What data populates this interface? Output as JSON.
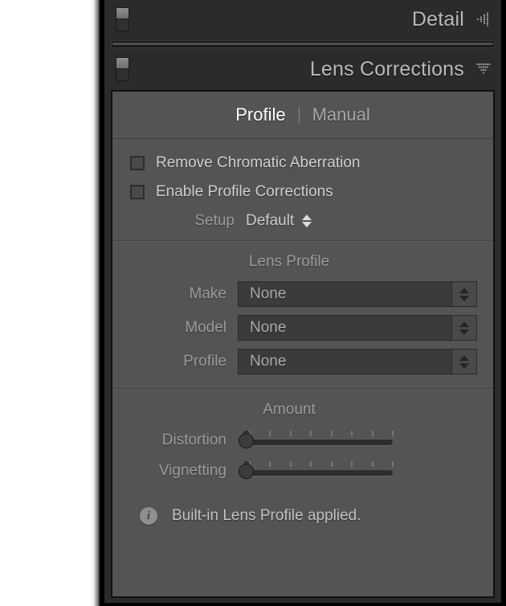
{
  "panels": [
    {
      "id": "detail",
      "title": "Detail",
      "toggle_state": "on",
      "collapse_icon": "dotted-triangle-left-icon",
      "expanded": false
    },
    {
      "id": "lens_corrections",
      "title": "Lens Corrections",
      "toggle_state": "on",
      "collapse_icon": "dotted-triangle-down-icon",
      "expanded": true
    }
  ],
  "lens_corrections": {
    "tabs": [
      {
        "label": "Profile",
        "active": true
      },
      {
        "label": "Manual",
        "active": false
      }
    ],
    "tab_separator": "|",
    "checkboxes": [
      {
        "label": "Remove Chromatic Aberration",
        "checked": false
      },
      {
        "label": "Enable Profile Corrections",
        "checked": false
      }
    ],
    "setup": {
      "label": "Setup",
      "value": "Default"
    },
    "lens_profile": {
      "title": "Lens Profile",
      "fields": [
        {
          "label": "Make",
          "value": "None"
        },
        {
          "label": "Model",
          "value": "None"
        },
        {
          "label": "Profile",
          "value": "None"
        }
      ]
    },
    "amount": {
      "title": "Amount",
      "sliders": [
        {
          "label": "Distortion",
          "value": 0,
          "min": 0,
          "max": 100,
          "tick_count": 8
        },
        {
          "label": "Vignetting",
          "value": 0,
          "min": 0,
          "max": 100,
          "tick_count": 8
        }
      ]
    },
    "note": {
      "icon": "info-icon",
      "icon_glyph": "i",
      "text": "Built-in Lens Profile applied."
    }
  },
  "colors": {
    "panel_body": "#545454",
    "chrome": "#2b2b2b",
    "border": "#111111",
    "text_primary": "#cfcfcf",
    "text_dim": "#9b9b9b",
    "text_active": "#ffffff",
    "control_fill": "#3b3b3b"
  }
}
